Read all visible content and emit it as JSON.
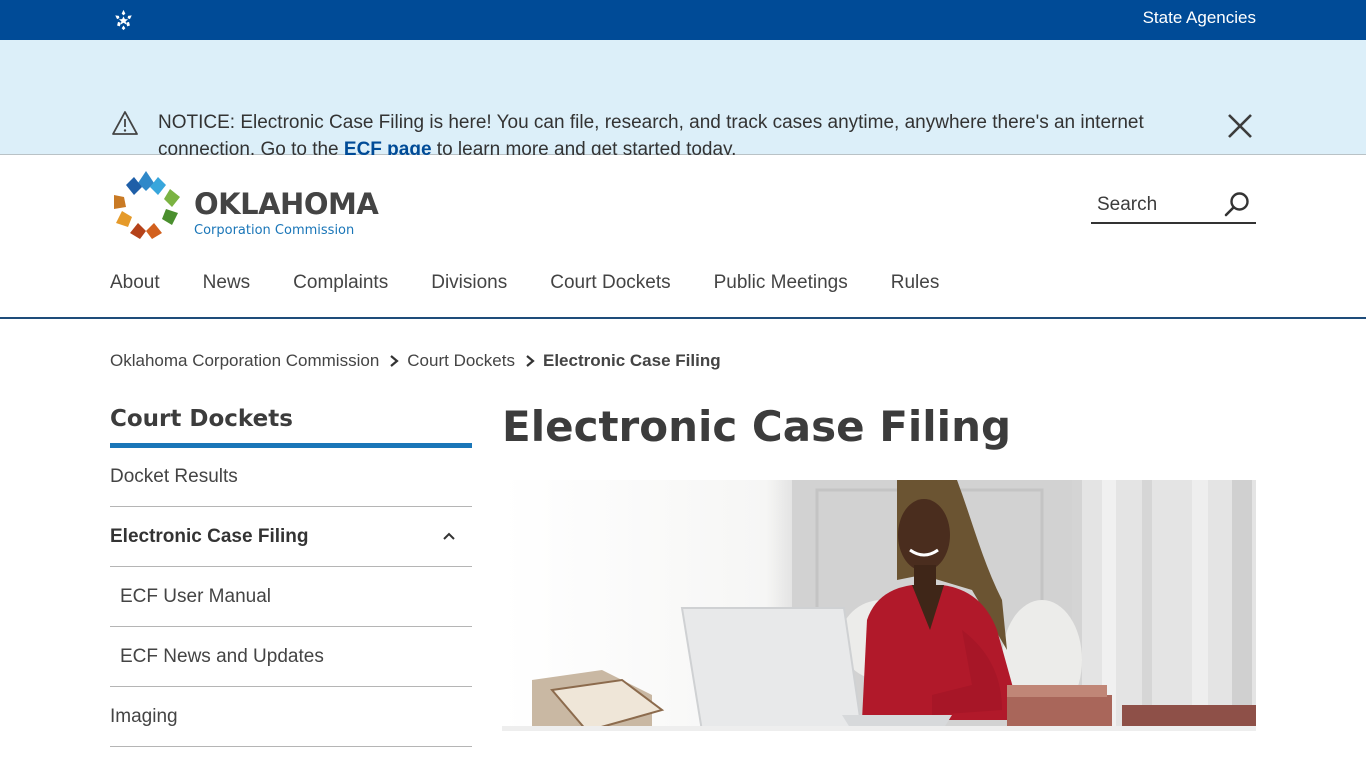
{
  "topbar": {
    "logo_icon": "oklahoma-star-icon",
    "state_agencies_label": "State Agencies"
  },
  "notice": {
    "icon": "warning-triangle-icon",
    "text_before": "NOTICE: Electronic Case Filing is here! You can file, research, and track cases anytime, anywhere there's an internet connection. Go to the ",
    "link_label": "ECF page",
    "text_after": " to learn more and get started today.",
    "close_icon": "close-icon"
  },
  "header": {
    "logo_title": "OKLAHOMA",
    "logo_subtitle": "Corporation Commission",
    "search_placeholder": "Search",
    "search_value": "",
    "search_icon": "search-icon"
  },
  "nav": {
    "items": [
      {
        "label": "About"
      },
      {
        "label": "News"
      },
      {
        "label": "Complaints"
      },
      {
        "label": "Divisions"
      },
      {
        "label": "Court Dockets"
      },
      {
        "label": "Public Meetings"
      },
      {
        "label": "Rules"
      }
    ]
  },
  "breadcrumb": {
    "items": [
      {
        "label": "Oklahoma Corporation Commission"
      },
      {
        "label": "Court Dockets"
      },
      {
        "label": "Electronic Case Filing"
      }
    ]
  },
  "sidenav": {
    "heading": "Court Dockets",
    "items": [
      {
        "label": "Docket Results"
      },
      {
        "label": "Electronic Case Filing",
        "expanded": true
      },
      {
        "label": "ECF User Manual"
      },
      {
        "label": "ECF News and Updates"
      },
      {
        "label": "Imaging"
      }
    ]
  },
  "content": {
    "title": "Electronic Case Filing",
    "hero_alt": "Woman smiling while working on a laptop at a desk with books"
  },
  "colors": {
    "topbar": "#004b97",
    "notice_bg": "#dceff9",
    "link": "#004b97",
    "accent": "#1a76b8",
    "nav_rule": "#1e4c7a"
  }
}
